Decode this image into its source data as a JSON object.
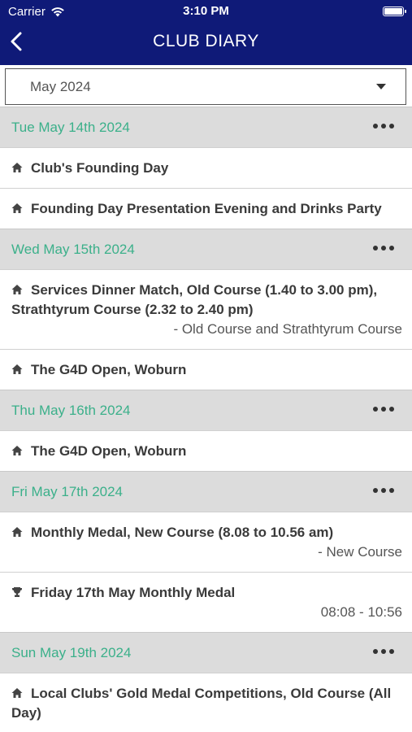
{
  "status_bar": {
    "carrier": "Carrier",
    "time": "3:10 PM"
  },
  "header": {
    "title": "CLUB DIARY"
  },
  "month_picker": {
    "value": "May 2024"
  },
  "days": [
    {
      "label": "Tue May 14th 2024",
      "events": [
        {
          "icon": "home-icon",
          "title": "Club's Founding Day",
          "sub": ""
        },
        {
          "icon": "home-icon",
          "title": "Founding Day Presentation Evening and Drinks Party",
          "sub": ""
        }
      ]
    },
    {
      "label": "Wed May 15th 2024",
      "events": [
        {
          "icon": "home-icon",
          "title": "Services Dinner Match, Old Course (1.40 to 3.00 pm), Strathtyrum Course (2.32 to 2.40 pm)",
          "sub": "- Old Course and Strathtyrum Course"
        },
        {
          "icon": "home-icon",
          "title": "The G4D Open, Woburn",
          "sub": ""
        }
      ]
    },
    {
      "label": "Thu May 16th 2024",
      "events": [
        {
          "icon": "home-icon",
          "title": "The G4D Open, Woburn",
          "sub": ""
        }
      ]
    },
    {
      "label": "Fri May 17th 2024",
      "events": [
        {
          "icon": "home-icon",
          "title": "Monthly Medal, New Course (8.08 to 10.56 am)",
          "sub": "- New Course"
        },
        {
          "icon": "trophy-icon",
          "title": "Friday 17th May Monthly Medal",
          "sub": "08:08 - 10:56"
        }
      ]
    },
    {
      "label": "Sun May 19th 2024",
      "events": [
        {
          "icon": "home-icon",
          "title": "Local Clubs' Gold Medal Competitions, Old Course (All Day)",
          "sub": ""
        }
      ]
    }
  ]
}
